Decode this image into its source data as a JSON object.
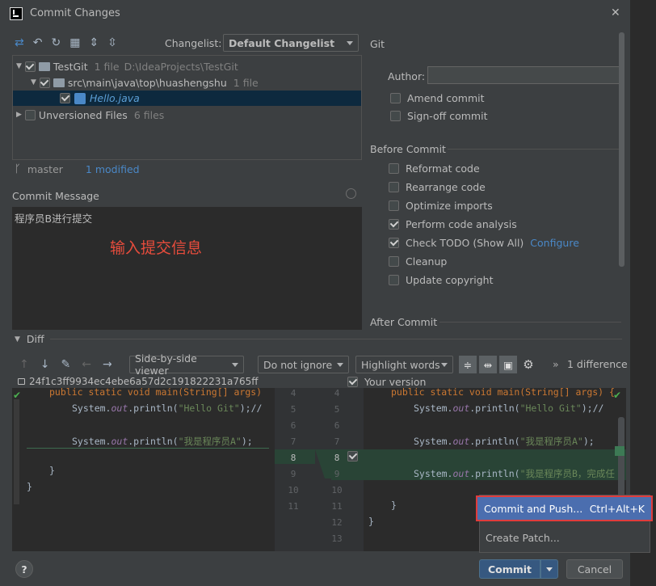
{
  "window": {
    "title": "Commit Changes",
    "close_glyph": "✕"
  },
  "toolbar": {
    "changelist_label": "Changelist:",
    "changelist_value": "Default Changelist"
  },
  "tree": {
    "root": {
      "name": "TestGit",
      "meta": "1 file",
      "path": "D:\\IdeaProjects\\TestGit"
    },
    "folder": {
      "name": "src\\main\\java\\top\\huashengshu",
      "meta": "1 file"
    },
    "file": {
      "name": "Hello.java"
    },
    "unversioned": {
      "name": "Unversioned Files",
      "meta": "6 files"
    }
  },
  "branch": {
    "name": "master",
    "modified": "1 modified"
  },
  "commit_message": {
    "label": "Commit Message",
    "text": "程序员B进行提交",
    "annotation": "输入提交信息"
  },
  "git_panel": {
    "title": "Git",
    "author_label": "Author:",
    "author_value": "",
    "amend": "Amend commit",
    "signoff": "Sign-off commit",
    "before_commit": "Before Commit",
    "options": [
      {
        "label": "Reformat code",
        "checked": false
      },
      {
        "label": "Rearrange code",
        "checked": false
      },
      {
        "label": "Optimize imports",
        "checked": false
      },
      {
        "label": "Perform code analysis",
        "checked": true
      },
      {
        "label": "Check TODO (Show All)",
        "checked": true,
        "link": "Configure"
      },
      {
        "label": "Cleanup",
        "checked": false
      },
      {
        "label": "Update copyright",
        "checked": false
      }
    ],
    "after_commit": "After Commit"
  },
  "diff": {
    "label": "Diff",
    "viewer": "Side-by-side viewer",
    "ignore": "Do not ignore",
    "highlight": "Highlight words",
    "count": "1 difference",
    "left_revision": "24f1c3ff9934ec4ebe6a57d2c191822231a765ff",
    "right_label": "Your version",
    "left_lines": [
      {
        "type": "sig",
        "text": "public static void main(String[] args)"
      },
      {
        "type": "println",
        "pre": "System.",
        "out": "out",
        "mid": ".println(",
        "str": "\"Hello Git\"",
        "post": ");//"
      },
      {
        "type": "blank",
        "text": ""
      },
      {
        "type": "println",
        "pre": "System.",
        "out": "out",
        "mid": ".println(",
        "str": "\"我是程序员A\"",
        "post": ");"
      },
      {
        "type": "blank",
        "text": ""
      },
      {
        "type": "plain",
        "text": "}"
      },
      {
        "type": "plain",
        "text": "}"
      }
    ],
    "gutter_left": [
      "4",
      "5",
      "6",
      "7",
      "8",
      "9",
      "10",
      "11"
    ],
    "gutter_right": [
      "4",
      "5",
      "6",
      "7",
      "8",
      "9",
      "10",
      "11",
      "12",
      "13"
    ],
    "right_lines": [
      {
        "type": "sig",
        "text": "public static void main(String[] args) {"
      },
      {
        "type": "println",
        "pre": "System.",
        "out": "out",
        "mid": ".println(",
        "str": "\"Hello Git\"",
        "post": ");//"
      },
      {
        "type": "blank",
        "text": ""
      },
      {
        "type": "println",
        "pre": "System.",
        "out": "out",
        "mid": ".println(",
        "str": "\"我是程序员A\"",
        "post": ");"
      },
      {
        "type": "blank",
        "text": ""
      },
      {
        "type": "println",
        "pre": "System.",
        "out": "out",
        "mid": ".println(",
        "str": "\"我是程序员B，完成任",
        "post": ""
      },
      {
        "type": "blank",
        "text": ""
      },
      {
        "type": "plain",
        "text": "}"
      },
      {
        "type": "plain",
        "text": "}"
      }
    ]
  },
  "commit_menu": {
    "items": [
      {
        "label": "Commit and Push...",
        "shortcut": "Ctrl+Alt+K"
      },
      {
        "label": "Create Patch...",
        "shortcut": ""
      }
    ]
  },
  "footer": {
    "help": "?",
    "commit": "Commit",
    "cancel": "Cancel"
  },
  "colors": {
    "accent": "#4a88c7",
    "highlight_box": "#e03c3c",
    "annotation": "#e74c3c",
    "diff_added": "#294436"
  }
}
